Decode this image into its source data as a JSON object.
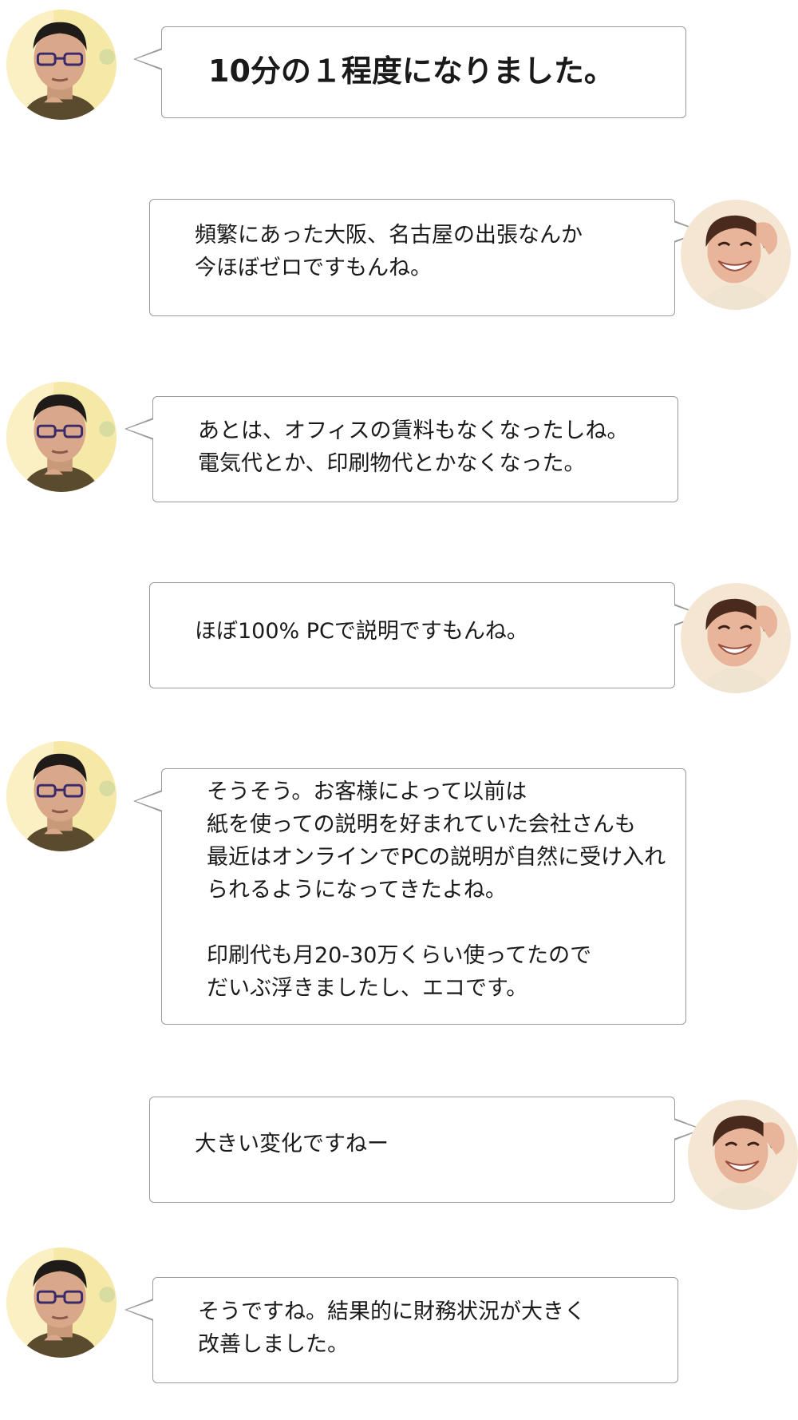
{
  "conversation": {
    "colors": {
      "bubble_border": "#9a9a9a",
      "bubble_bg": "#ffffff",
      "text": "#1a1a1a",
      "avatar_male_bg": "#f6e8a6",
      "avatar_female_bg": "#f4e6d2"
    },
    "messages": [
      {
        "speaker": "man",
        "avatar_icon": "man-with-glasses-avatar",
        "lines": [
          "10分の１程度になりました。"
        ]
      },
      {
        "speaker": "woman",
        "avatar_icon": "smiling-woman-avatar",
        "lines": [
          "頻繁にあった大阪、名古屋の出張なんか",
          "今ほぼゼロですもんね。"
        ]
      },
      {
        "speaker": "man",
        "avatar_icon": "man-with-glasses-avatar",
        "lines": [
          "あとは、オフィスの賃料もなくなったしね。",
          "電気代とか、印刷物代とかなくなった。"
        ]
      },
      {
        "speaker": "woman",
        "avatar_icon": "smiling-woman-avatar",
        "lines": [
          "ほぼ100% PCで説明ですもんね。"
        ]
      },
      {
        "speaker": "man",
        "avatar_icon": "man-with-glasses-avatar",
        "lines": [
          "そうそう。お客様によって以前は",
          "紙を使っての説明を好まれていた会社さんも",
          "最近はオンラインでPCの説明が自然に受け入れ",
          "られるようになってきたよね。",
          "",
          "印刷代も月20-30万くらい使ってたので",
          "だいぶ浮きましたし、エコです。"
        ]
      },
      {
        "speaker": "woman",
        "avatar_icon": "smiling-woman-avatar",
        "lines": [
          "大きい変化ですねー"
        ]
      },
      {
        "speaker": "man",
        "avatar_icon": "man-with-glasses-avatar",
        "lines": [
          "そうですね。結果的に財務状況が大きく",
          "改善しました。"
        ]
      }
    ]
  }
}
